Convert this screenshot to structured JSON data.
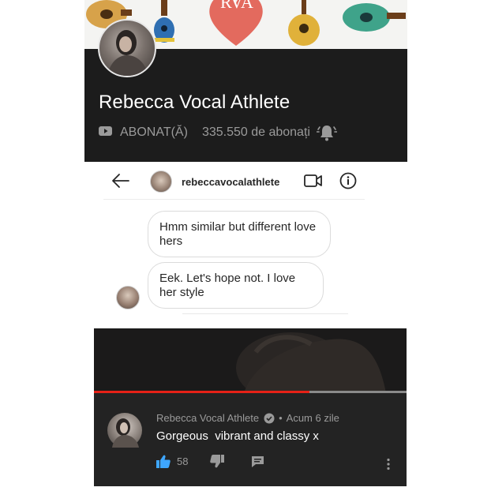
{
  "banner": {
    "text": "RVA"
  },
  "channel": {
    "name": "Rebecca Vocal Athlete",
    "subscribed_label": "ABONAT(Ă)",
    "subscriber_count": "335.550 de abonați"
  },
  "dm": {
    "username": "rebeccavocalathlete",
    "messages": [
      {
        "text": "Hmm similar but different love hers"
      },
      {
        "text": "Eek. Let's hope not. I love her style"
      }
    ]
  },
  "video": {
    "progress": 0.69
  },
  "comment": {
    "author": "Rebecca Vocal Athlete",
    "time": "Acum 6 zile",
    "separator": "•",
    "text": "Gorgeous  vibrant and classy x",
    "likes": "58"
  },
  "colors": {
    "youtube_header": "#1c1c1c",
    "comment_bg": "#232323",
    "progress_red": "#e62117",
    "like_blue": "#3ea6ff",
    "subscribed_gray": "#9a9a9a"
  }
}
